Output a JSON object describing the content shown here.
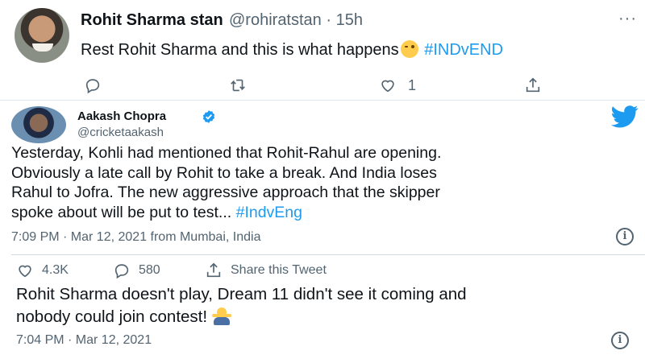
{
  "reply_tweet": {
    "display_name": "Rohit Sharma stan",
    "meta": "@rohiratstan · 15h",
    "more": "···",
    "text_before": "Rest Rohit Sharma  and this is what happens",
    "hashtag": "#INDvEND",
    "like_count": "1",
    "icons": [
      "reply-icon",
      "retweet-icon",
      "like-icon",
      "share-icon"
    ]
  },
  "quoted_tweet": {
    "display_name": "Aakash Chopra",
    "handle": "@cricketaakash",
    "body_lines": [
      "Yesterday, Kohli had mentioned that Rohit-Rahul are opening.",
      "Obviously a late call by Rohit to take a break. And India loses",
      "Rahul to Jofra. The new aggressive approach that the skipper"
    ],
    "last_line_text": "spoke about will be put to test... ",
    "hashtag": "#IndvEng",
    "timestamp": "7:09 PM · Mar 12, 2021 from Mumbai, India",
    "likes": "4.3K",
    "replies": "580",
    "share_label": "Share this Tweet",
    "info_glyph": "i"
  },
  "third_post": {
    "lines": [
      "Rohit Sharma doesn't play, Dream 11 didn't see it coming and",
      "nobody could join contest!"
    ],
    "timestamp": "7:04 PM · Mar 12, 2021",
    "info_glyph": "i"
  },
  "colors": {
    "accent": "#1d9bf0",
    "text": "#0f1419",
    "muted": "#536471",
    "heart": "#e0245e"
  }
}
